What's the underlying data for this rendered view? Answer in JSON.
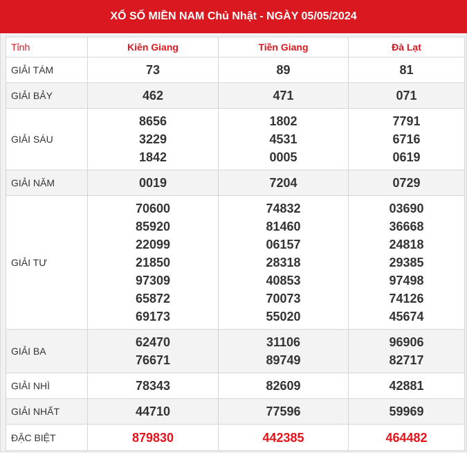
{
  "title": "XỔ SỐ MIỀN NAM Chủ Nhật - NGÀY 05/05/2024",
  "header_label": "Tỉnh",
  "provinces": [
    "Kiên Giang",
    "Tiền Giang",
    "Đà Lạt"
  ],
  "prizes": [
    {
      "label": "GIẢI TÁM",
      "values": [
        [
          "73"
        ],
        [
          "89"
        ],
        [
          "81"
        ]
      ]
    },
    {
      "label": "GIẢI BẢY",
      "values": [
        [
          "462"
        ],
        [
          "471"
        ],
        [
          "071"
        ]
      ]
    },
    {
      "label": "GIẢI SÁU",
      "values": [
        [
          "8656",
          "3229",
          "1842"
        ],
        [
          "1802",
          "4531",
          "0005"
        ],
        [
          "7791",
          "6716",
          "0619"
        ]
      ]
    },
    {
      "label": "GIẢI NĂM",
      "values": [
        [
          "0019"
        ],
        [
          "7204"
        ],
        [
          "0729"
        ]
      ]
    },
    {
      "label": "GIẢI TƯ",
      "values": [
        [
          "70600",
          "85920",
          "22099",
          "21850",
          "97309",
          "65872",
          "69173"
        ],
        [
          "74832",
          "81460",
          "06157",
          "28318",
          "40853",
          "70073",
          "55020"
        ],
        [
          "03690",
          "36668",
          "24818",
          "29385",
          "97498",
          "74126",
          "45674"
        ]
      ]
    },
    {
      "label": "GIẢI BA",
      "values": [
        [
          "62470",
          "76671"
        ],
        [
          "31106",
          "89749"
        ],
        [
          "96906",
          "82717"
        ]
      ]
    },
    {
      "label": "GIẢI NHÌ",
      "values": [
        [
          "78343"
        ],
        [
          "82609"
        ],
        [
          "42881"
        ]
      ]
    },
    {
      "label": "GIẢI NHẤT",
      "values": [
        [
          "44710"
        ],
        [
          "77596"
        ],
        [
          "59969"
        ]
      ]
    },
    {
      "label": "ĐẶC BIỆT",
      "values": [
        [
          "879830"
        ],
        [
          "442385"
        ],
        [
          "464482"
        ]
      ],
      "special": true
    }
  ],
  "colors": {
    "accent": "#d9181f",
    "special": "#e3121b",
    "text": "#333333"
  }
}
